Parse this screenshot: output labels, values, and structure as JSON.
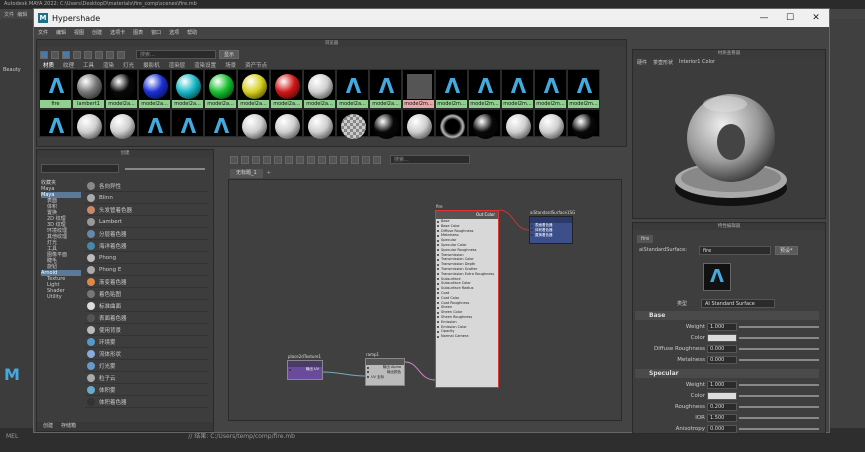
{
  "background_app": {
    "top_text": "Autodesk MAYA 2022: C:\\Users\\DesktopD\\materials\\fire_comp\\scenes\\fire.mb",
    "menu": [
      "文件",
      "编辑"
    ],
    "left_tab": "Beauty",
    "bottom_text": "MEL",
    "bottom_status": "// 结果: C:/Users/temp/comp/fire.mb"
  },
  "window": {
    "title": "Hypershade",
    "controls": [
      "—",
      "☐",
      "✕"
    ]
  },
  "menubar": [
    "文件",
    "编辑",
    "视图",
    "创建",
    "选项卡",
    "图表",
    "窗口",
    "选项",
    "帮助"
  ],
  "browser": {
    "title": "浏览器",
    "search_placeholder": "搜索...",
    "button": "显示",
    "tabs": [
      "材质",
      "纹理",
      "工具",
      "渲染",
      "灯光",
      "摄影机",
      "渲染层",
      "渲染设置",
      "场景",
      "资产节点"
    ],
    "row1": [
      {
        "label": "fire",
        "sw": "arnold",
        "sel": false
      },
      {
        "label": "lambert1",
        "sw": "gray",
        "sel": false
      },
      {
        "label": "model2a...",
        "sw": "black",
        "sel": false
      },
      {
        "label": "model2a...",
        "sw": "blue",
        "sel": false
      },
      {
        "label": "model2a...",
        "sw": "cyan",
        "sel": false
      },
      {
        "label": "model2a...",
        "sw": "green",
        "sel": false
      },
      {
        "label": "model2a...",
        "sw": "yellow",
        "sel": false
      },
      {
        "label": "model2a...",
        "sw": "red",
        "sel": false
      },
      {
        "label": "model2a...",
        "sw": "white",
        "sel": false
      },
      {
        "label": "model2a...",
        "sw": "arnold",
        "sel": false
      },
      {
        "label": "model2a...",
        "sw": "arnold",
        "sel": false
      },
      {
        "label": "model2m...",
        "sw": "cube",
        "sel": true
      },
      {
        "label": "model2m...",
        "sw": "arnold",
        "sel": false
      },
      {
        "label": "model2m...",
        "sw": "arnold",
        "sel": false
      },
      {
        "label": "model2m...",
        "sw": "arnold",
        "sel": false
      },
      {
        "label": "model2m...",
        "sw": "arnold",
        "sel": false
      },
      {
        "label": "model2m...",
        "sw": "arnold",
        "sel": false
      }
    ],
    "row2": [
      "arnold",
      "white",
      "white",
      "arnold",
      "arnold",
      "arnold",
      "white",
      "white",
      "white",
      "checker",
      "black",
      "white",
      "ring",
      "black",
      "white",
      "white",
      "black"
    ]
  },
  "create": {
    "title": "创建",
    "tree": [
      "收藏夹",
      "Maya",
      "Maya",
      "表面",
      "体积",
      "置换",
      "2D 纹理",
      "3D 纹理",
      "环境纹理",
      "其他纹理",
      "灯光",
      "工具",
      "图像平面",
      "睫毛",
      "旋钮",
      "Arnold",
      "Texture",
      "Light",
      "Shader",
      "Utility"
    ],
    "items": [
      {
        "label": "各向异性",
        "color": "#888"
      },
      {
        "label": "Blinn",
        "color": "#aaa"
      },
      {
        "label": "头发管着色器",
        "color": "#c86"
      },
      {
        "label": "Lambert",
        "color": "#999"
      },
      {
        "label": "分层着色器",
        "color": "#68a"
      },
      {
        "label": "海洋着色器",
        "color": "#48a"
      },
      {
        "label": "Phong",
        "color": "#bbb"
      },
      {
        "label": "Phong E",
        "color": "#aaa"
      },
      {
        "label": "渐变着色器",
        "color": "#d84"
      },
      {
        "label": "着色贴图",
        "color": "#777"
      },
      {
        "label": "标准曲面",
        "color": "#ddd"
      },
      {
        "label": "表面着色器",
        "color": "#555"
      },
      {
        "label": "使用背景",
        "color": "#bbb"
      },
      {
        "label": "环境雾",
        "color": "#59c"
      },
      {
        "label": "流体形状",
        "color": "#8ad"
      },
      {
        "label": "灯光雾",
        "color": "#69c"
      },
      {
        "label": "粒子云",
        "color": "#aaa"
      },
      {
        "label": "体积雾",
        "color": "#6ac"
      },
      {
        "label": "体积着色器",
        "color": "#333"
      }
    ],
    "bottom_tabs": [
      "创建",
      "存储箱"
    ]
  },
  "graph": {
    "search_placeholder": "搜索...",
    "tab": "无标题_1",
    "add_tab": "+",
    "node_fire": {
      "name": "fire",
      "out": "Out Color",
      "attrs": [
        "Base",
        "Base Color",
        "Diffuse Roughness",
        "Metalness",
        "Specular",
        "Specular Color",
        "Specular Roughness",
        "Transmission",
        "Transmission Color",
        "Transmission Depth",
        "Transmission Scatter",
        "Transmission Extra Roughness",
        "Subsurface",
        "Subsurface Color",
        "Subsurface Radius",
        "Coat",
        "Coat Color",
        "Coat Roughness",
        "Sheen",
        "Sheen Color",
        "Sheen Roughness",
        "Emission",
        "Emission Color",
        "Opacity",
        "Normal Camera"
      ]
    },
    "node_sg": {
      "name": "aiStandardSurface1SG",
      "ports": [
        "表面着色器",
        "体积着色器",
        "置换着色器"
      ]
    },
    "node_ramp": {
      "name": "ramp1",
      "ports": [
        "输出 Alpha",
        "输出颜色"
      ],
      "in": "UV 坐标"
    },
    "node_place": {
      "name": "place2dTexture1",
      "port": "输出 UV"
    }
  },
  "preview": {
    "title": "材质查看器",
    "mode": "硬件",
    "shape": "茶壶形状",
    "env": "Interior1 Color"
  },
  "ae": {
    "title": "特性编辑器",
    "tab": "fire",
    "type_label": "aiStandardSurface:",
    "name": "fire",
    "preset": "预设*",
    "type_key": "类型",
    "type_val": "AI Standard Surface",
    "sec_base": "Base",
    "sec_spec": "Specular",
    "base": [
      {
        "k": "Weight",
        "v": "1.000"
      },
      {
        "k": "Color",
        "v": ""
      },
      {
        "k": "Diffuse Roughness",
        "v": "0.000"
      },
      {
        "k": "Metalness",
        "v": "0.000"
      }
    ],
    "spec": [
      {
        "k": "Weight",
        "v": "1.000"
      },
      {
        "k": "Color",
        "v": ""
      },
      {
        "k": "Roughness",
        "v": "0.200"
      },
      {
        "k": "IOR",
        "v": "1.500"
      },
      {
        "k": "Anisotropy",
        "v": "0.000"
      }
    ]
  }
}
